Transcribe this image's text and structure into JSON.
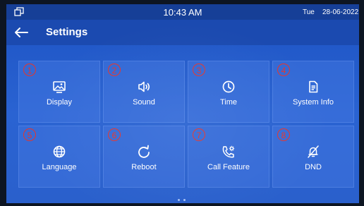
{
  "status_bar": {
    "time": "10:43 AM",
    "day": "Tue",
    "date": "28-06-2022",
    "left_icon": "window-restore-icon"
  },
  "header": {
    "back_icon": "back-arrow-icon",
    "title": "Settings"
  },
  "tiles": [
    {
      "number": "1",
      "label": "Display",
      "icon": "display-image-icon"
    },
    {
      "number": "2",
      "label": "Sound",
      "icon": "speaker-icon"
    },
    {
      "number": "3",
      "label": "Time",
      "icon": "clock-icon"
    },
    {
      "number": "4",
      "label": "System Info",
      "icon": "document-icon"
    },
    {
      "number": "5",
      "label": "Language",
      "icon": "globe-icon"
    },
    {
      "number": "6",
      "label": "Reboot",
      "icon": "reboot-icon"
    },
    {
      "number": "7",
      "label": "Call Feature",
      "icon": "phone-gear-icon"
    },
    {
      "number": "8",
      "label": "DND",
      "icon": "bell-off-icon"
    }
  ],
  "colors": {
    "screen_blue": "#2a63d2",
    "status_bar": "#163f97",
    "annotation_red": "#e8342a"
  }
}
